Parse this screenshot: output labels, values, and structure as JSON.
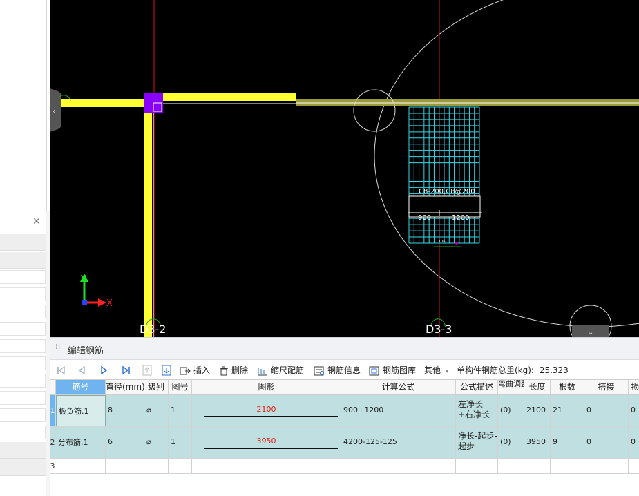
{
  "canvas": {
    "labels": {
      "axis_left": "D3-2",
      "axis_right": "D3-3",
      "rebar_text": "C8-200,C8@200",
      "dim_left": "900",
      "dim_right": "1200",
      "small_mark": "106"
    },
    "coord_axes": {
      "x": "X",
      "y": "Y"
    }
  },
  "editor": {
    "title": "编辑钢筋",
    "toolbar": {
      "insert": "插入",
      "delete": "删除",
      "scale_config": "缩尺配筋",
      "rebar_info": "钢筋信息",
      "rebar_library": "钢筋图库",
      "other": "其他",
      "total_weight_label": "单构件钢筋总重(kg):",
      "total_weight_value": "25.323"
    },
    "columns": [
      "筋号",
      "直径(mm)",
      "级别",
      "图号",
      "图形",
      "计算公式",
      "公式描述",
      "弯曲调整",
      "长度",
      "根数",
      "搭接",
      "损"
    ],
    "rows": [
      {
        "num": "1",
        "name": "板负筋.1",
        "diameter": "8",
        "grade": "⌀",
        "fig": "1",
        "shape_value": "2100",
        "formula": "900+1200",
        "desc": "左净长+右净长",
        "bend": "(0)",
        "length": "2100",
        "count": "21",
        "lap": "0",
        "loss": "0"
      },
      {
        "num": "2",
        "name": "分布筋.1",
        "diameter": "6",
        "grade": "⌀",
        "fig": "1",
        "shape_value": "3950",
        "formula": "4200-125-125",
        "desc": "净长-起步-起步",
        "bend": "(0)",
        "length": "3950",
        "count": "9",
        "lap": "0",
        "loss": "0"
      },
      {
        "num": "3"
      }
    ]
  },
  "colors": {
    "grid_selected": "#c0dfe0",
    "header_active": "#6fb3ef",
    "beam": "#ffff33",
    "column": "#8a00ff",
    "mesh": "#35d8e8",
    "axis": "#e01010"
  }
}
